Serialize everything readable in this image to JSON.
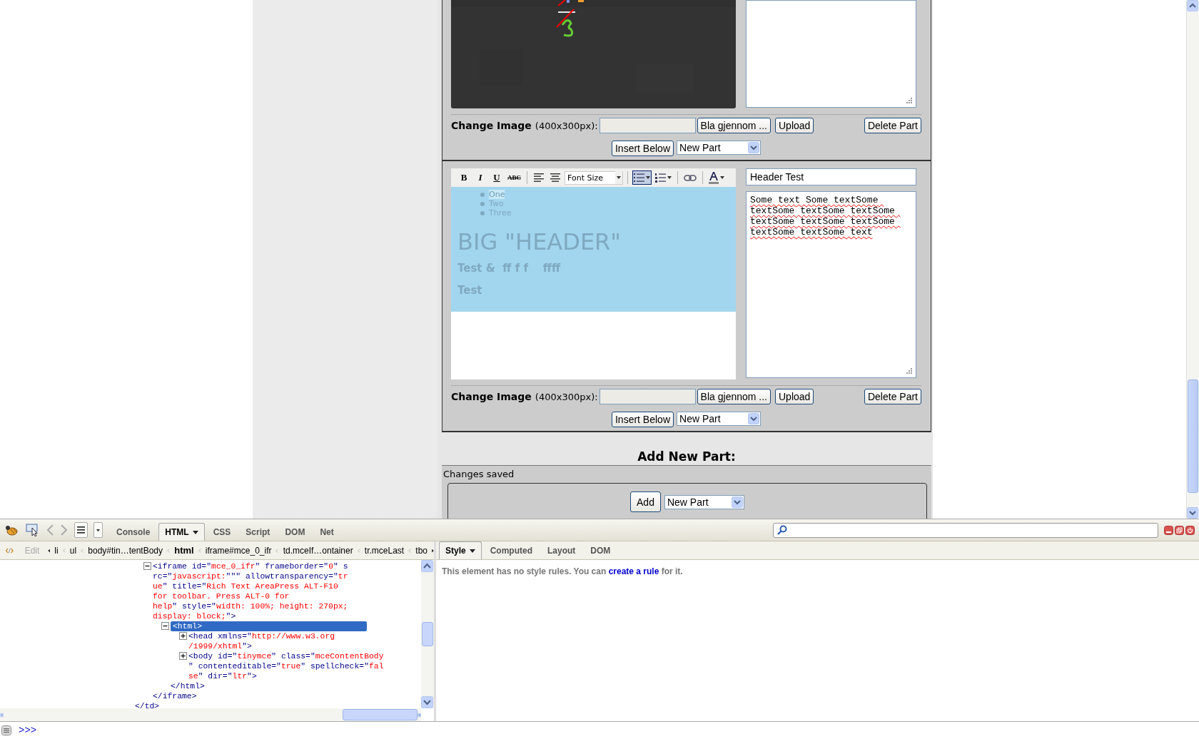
{
  "parts": [
    {
      "change_image": {
        "label": "Change Image",
        "hint": "(400x300px):",
        "browse": "Bla gjennom ...",
        "upload": "Upload"
      },
      "delete": "Delete Part",
      "insert": "Insert Below",
      "part_type": "New Part"
    },
    {
      "kind": "text",
      "editor": {
        "toolbar": [
          {
            "kind": "bold",
            "label": "B",
            "active": false
          },
          {
            "kind": "italic",
            "label": "I",
            "active": false
          },
          {
            "kind": "underline",
            "label": "U",
            "active": false
          },
          {
            "kind": "strikethrough",
            "label": "ABC",
            "active": false
          },
          {
            "kind": "separator"
          },
          {
            "kind": "align-left",
            "active": false
          },
          {
            "kind": "align-center",
            "active": false
          },
          {
            "kind": "font-size",
            "label": "Font Size"
          },
          {
            "kind": "separator"
          },
          {
            "kind": "bullet-list",
            "active": true,
            "menu": true
          },
          {
            "kind": "numbered-list",
            "active": false,
            "menu": true
          },
          {
            "kind": "separator"
          },
          {
            "kind": "link",
            "active": false
          },
          {
            "kind": "separator"
          },
          {
            "kind": "font-color",
            "active": false,
            "menu": true
          }
        ],
        "list": [
          {
            "text": "One",
            "selected": true
          },
          {
            "text": "Two",
            "selected": false
          },
          {
            "text": "Three",
            "selected": false
          }
        ],
        "heading": "BIG \"HEADER\"",
        "paragraphs": [
          "Test &  ff f f    ffff",
          "Test"
        ]
      },
      "header_field": "Header Test",
      "body_text": "Some text Some textSome textSome textSome textSome textSome textSome textSome textSome textSome text",
      "spellcheck_marks": true,
      "change_image": {
        "label": "Change Image",
        "hint": "(400x300px):",
        "browse": "Bla gjennom ...",
        "upload": "Upload"
      },
      "delete": "Delete Part",
      "insert": "Insert Below",
      "part_type": "New Part"
    }
  ],
  "add_part": {
    "title": "Add New Part:",
    "status": "Changes saved",
    "button": "Add",
    "part_type": "New Part"
  },
  "firebug": {
    "tabs": [
      {
        "label": "Console",
        "selected": false,
        "menu": false
      },
      {
        "label": "HTML",
        "selected": true,
        "menu": true
      },
      {
        "label": "CSS",
        "selected": false,
        "menu": false
      },
      {
        "label": "Script",
        "selected": false,
        "menu": false
      },
      {
        "label": "DOM",
        "selected": false,
        "menu": false
      },
      {
        "label": "Net",
        "selected": false,
        "menu": false
      }
    ],
    "edit": {
      "label": "Edit",
      "disabled": true
    },
    "breadcrumbs": [
      {
        "label": "li",
        "selected": false
      },
      {
        "label": "ul",
        "selected": false
      },
      {
        "label": "body#tin…tentBody",
        "selected": false
      },
      {
        "label": "html",
        "selected": true
      },
      {
        "label": "iframe#mce_0_ifr",
        "selected": false
      },
      {
        "label": "td.mceIf…ontainer",
        "selected": false
      },
      {
        "label": "tr.mceLast",
        "selected": false
      },
      {
        "label": "tbo",
        "selected": false
      }
    ],
    "tree": [
      {
        "closing": "</td>",
        "children": [
          {
            "text": "<iframe id=\"mce_0_ifr\" frameborder=\"0\" s\nrc=\"javascript:\"\"\" allowtransparency=\"tr\nue\" title=\"Rich Text AreaPress ALT-F10\nfor toolbar. Press ALT-0 for\nhelp\" style=\"width: 100%; height: 270px;\ndisplay: block;\">",
            "expanded": true,
            "selected": false,
            "closing": "</iframe>",
            "children": [
              {
                "text": "<html>",
                "expanded": true,
                "selected": true,
                "closing": "</html>",
                "children": [
                  {
                    "text": "<head xmlns=\"http://www.w3.org\n/1999/xhtml\">",
                    "expanded": false,
                    "selected": false
                  },
                  {
                    "text": "<body id=\"tinymce\" class=\"mceContentBody\n\" contenteditable=\"true\" spellcheck=\"fal\nse\" dir=\"ltr\">",
                    "expanded": false,
                    "selected": false
                  }
                ]
              }
            ]
          }
        ]
      }
    ],
    "side_tabs": [
      {
        "label": "Style",
        "selected": true,
        "menu": true
      },
      {
        "label": "Computed",
        "selected": false,
        "menu": false
      },
      {
        "label": "Layout",
        "selected": false,
        "menu": false
      },
      {
        "label": "DOM",
        "selected": false,
        "menu": false
      }
    ],
    "style_message": {
      "before": "This element has no style rules. You can ",
      "link": "create a rule",
      "after": " for it."
    },
    "command_prompt": ">>>"
  }
}
